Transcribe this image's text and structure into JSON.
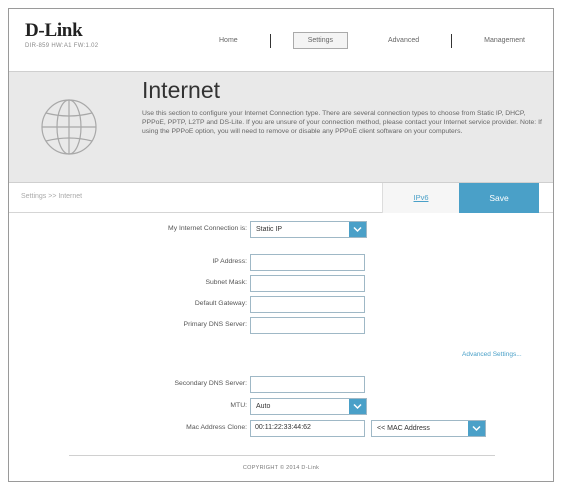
{
  "brand": {
    "name": "D-Link",
    "model": "DIR-859   HW:A1   FW:1.02"
  },
  "nav": {
    "home": "Home",
    "settings": "Settings",
    "advanced": "Advanced",
    "management": "Management"
  },
  "page": {
    "title": "Internet",
    "description": "Use this section to configure your Internet Connection type. There are several connection types to choose from Static IP, DHCP, PPPoE, PPTP, L2TP and DS-Lite. If you are unsure of your connection method, please contact your Internet service provider. Note: If using the PPPoE option, you will need to remove or disable any PPPoE client software on your computers."
  },
  "breadcrumb": "Settings >> Internet",
  "actions": {
    "ipv6": "IPv6",
    "save": "Save"
  },
  "form": {
    "connection": {
      "label": "My Internet Connection is:",
      "value": "Static IP"
    },
    "ip_address": {
      "label": "IP Address:",
      "value": ""
    },
    "subnet_mask": {
      "label": "Subnet Mask:",
      "value": ""
    },
    "default_gateway": {
      "label": "Default Gateway:",
      "value": ""
    },
    "primary_dns": {
      "label": "Primary DNS Server:",
      "value": ""
    },
    "advanced_settings": "Advanced Settings...",
    "secondary_dns": {
      "label": "Secondary DNS Server:",
      "value": ""
    },
    "mtu": {
      "label": "MTU:",
      "value": "Auto"
    },
    "mac_clone": {
      "label": "Mac Address Clone:",
      "value": "00:11:22:33:44:62",
      "select_value": "<< MAC Address"
    }
  },
  "footer": "COPYRIGHT © 2014 D-Link",
  "colors": {
    "accent": "#4aa0c8",
    "banner_bg": "#e9e9e9"
  }
}
